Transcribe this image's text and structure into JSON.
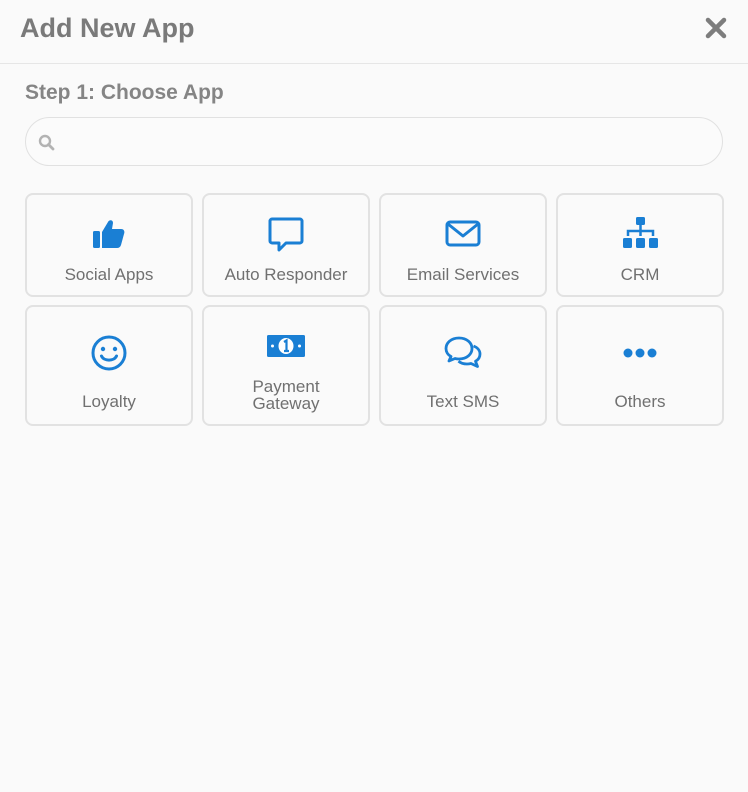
{
  "modal": {
    "title": "Add New App",
    "close_icon": "close-icon"
  },
  "step": {
    "label": "Step 1: Choose App"
  },
  "search": {
    "placeholder": "",
    "value": "",
    "icon": "search-icon"
  },
  "accent_color": "#1a7fd4",
  "categories": [
    {
      "label": "Social Apps",
      "icon": "thumbs-up-icon"
    },
    {
      "label": "Auto Responder",
      "icon": "speech-bubble-icon"
    },
    {
      "label": "Email Services",
      "icon": "envelope-icon"
    },
    {
      "label": "CRM",
      "icon": "sitemap-icon"
    },
    {
      "label": "Loyalty",
      "icon": "smiley-icon"
    },
    {
      "label": "Payment Gateway",
      "icon": "banknote-icon"
    },
    {
      "label": "Text SMS",
      "icon": "chat-bubbles-icon"
    },
    {
      "label": "Others",
      "icon": "ellipsis-icon"
    }
  ]
}
